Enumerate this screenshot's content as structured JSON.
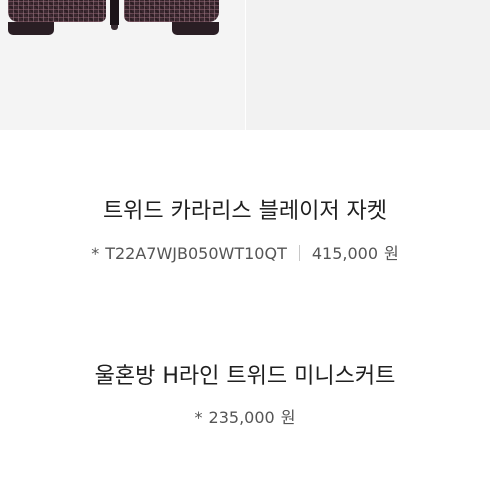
{
  "products": [
    {
      "name": "트위드 카라리스 블레이저 자켓",
      "bullet": "*",
      "code": "T22A7WJB050WT10QT",
      "price": "415,000",
      "currency": "원"
    },
    {
      "name": "울혼방 H라인 트위드 미니스커트",
      "bullet": "*",
      "price": "235,000",
      "currency": "원"
    }
  ],
  "colors": {
    "tweed_base": "#3b2830",
    "image_background": "#f4f4f4",
    "title_text": "#1f1f1f",
    "meta_text": "#555555"
  }
}
